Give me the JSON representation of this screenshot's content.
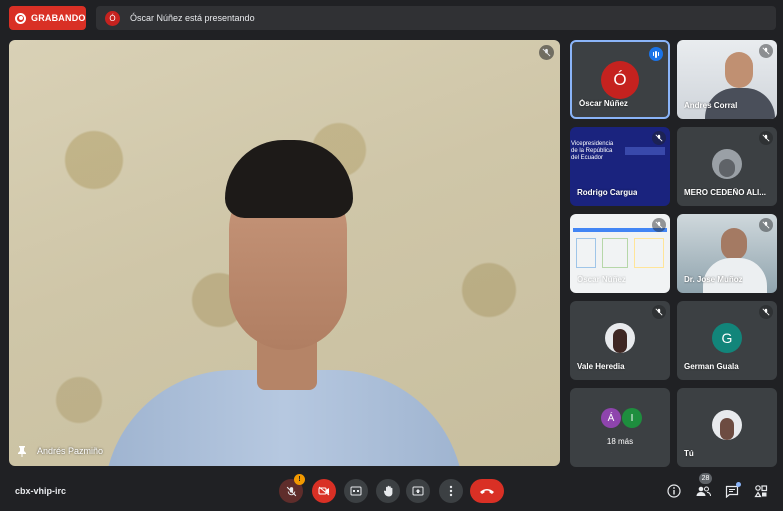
{
  "recording": {
    "label": "GRABANDO"
  },
  "presenting": {
    "avatar_initial": "Ó",
    "text": "Óscar Núñez está presentando"
  },
  "main_speaker": {
    "name": "Andrés Pazmiño"
  },
  "tiles": [
    {
      "name": "Óscar Núñez",
      "initial": "Ó"
    },
    {
      "name": "Andres Corral"
    },
    {
      "name": "Rodrigo Cargua",
      "slide_text": "Vicepresidencia de la República del Ecuador"
    },
    {
      "name": "MERO CEDEÑO ALI..."
    },
    {
      "name": "Óscar Núñez"
    },
    {
      "name": "Dr. Jose Muñoz"
    },
    {
      "name": "Vale Heredia"
    },
    {
      "name": "German Guala",
      "initial": "G"
    },
    {
      "more_label": "18 más",
      "initials": [
        "Á",
        "I"
      ]
    },
    {
      "name": "Tú"
    }
  ],
  "bottom_bar": {
    "meeting_code": "cbx-vhip-irc",
    "mic_warning": "!",
    "people_count": "28"
  },
  "colors": {
    "accent_blue": "#1a73e8",
    "danger_red": "#d93025",
    "german_avatar": "#12857a"
  }
}
